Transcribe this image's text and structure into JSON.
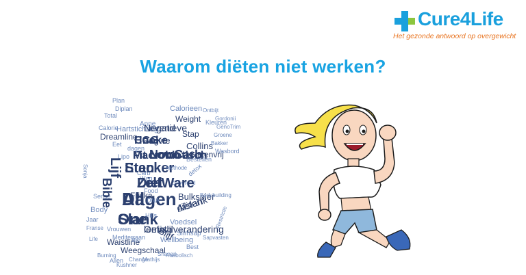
{
  "logo": {
    "name": "Cure4Life",
    "tagline": "Het gezonde antwoord op overgewicht",
    "brand_blue": "#1aa0dd",
    "brand_orange": "#e8731f"
  },
  "title": "Waarom diëten niet werken?",
  "word_cloud": {
    "words": [
      "Dagen",
      "Slank",
      "Diet",
      "Stacker",
      "LowCarb",
      "Fit",
      "HCG",
      "Levend",
      "Rauwe",
      "Ornish",
      "Afslank",
      "Weegschaal",
      "Waistline",
      "Wellbeing",
      "Voedsel",
      "Slimsap",
      "Glutenvrij",
      "Collins",
      "Stap",
      "Weight",
      "Calorieen",
      "Dreamline",
      "Hartstichting",
      "Body",
      "Sense",
      "Anne",
      "Diplan",
      "Total",
      "Vrouwen",
      "Mediterraan",
      "Burning",
      "Allen",
      "Kushner",
      "Change",
      "Mathijs",
      "Shangri",
      "Anabolisch",
      "Best",
      "Sapvasten",
      "Restrictie",
      "Kleuren",
      "Ontbijt",
      "Gordonii",
      "GenoTrim",
      "Groene",
      "Methode",
      "Bulkspier",
      "Bodybuilding",
      "Zuiverend",
      "Bakker",
      "Wasbord",
      "Bestellen",
      "detox",
      "dagen",
      "Lipo",
      "Eet",
      "Hills",
      "Bio",
      "Life",
      "Franse",
      "Jaar",
      "Weg",
      "Food",
      "Carb",
      "DNA",
      "Bible",
      "Lijf",
      "Blijf",
      "Sonja",
      "Friska",
      "Plan",
      "Calorie",
      "All",
      "One",
      "ZelfWare",
      "Eten",
      "Novo",
      "Macrobiotisch",
      "Cooke",
      "Negatieve",
      "Dag",
      "leefstijlverandering",
      "diëten"
    ],
    "color_dark": "#2b3f6e",
    "color_light": "#6f8bbd"
  },
  "illustration": "running-woman"
}
